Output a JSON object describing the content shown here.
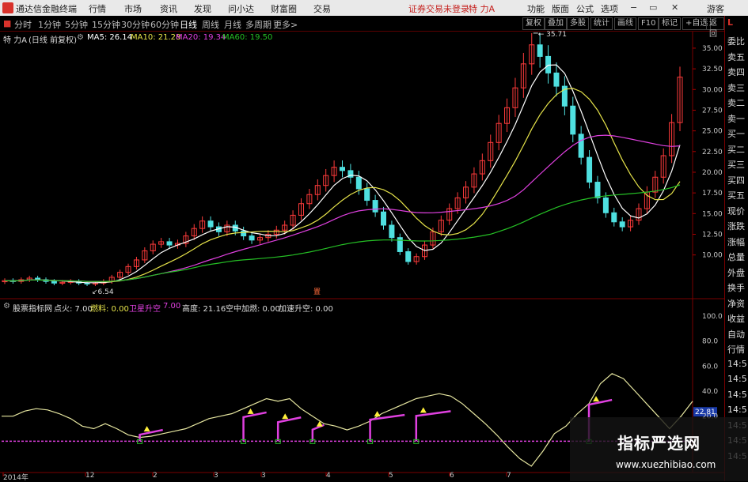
{
  "app": {
    "title": "通达信金融终端",
    "status": "证券交易未登录",
    "stock": "特 力A",
    "guest": "游客"
  },
  "menu": {
    "items": [
      "行情",
      "市场",
      "资讯",
      "发现",
      "问小达",
      "财富圈",
      "交易"
    ],
    "right": [
      "功能",
      "版面",
      "公式",
      "选项"
    ]
  },
  "window_controls": [
    "−",
    "▭",
    "✕"
  ],
  "toolbar": {
    "periods": [
      "分时",
      "1分钟",
      "5分钟",
      "15分钟",
      "30分钟",
      "60分钟",
      "日线",
      "周线",
      "月线",
      "多周期",
      "更多>"
    ],
    "selected": "日线",
    "right_buttons": [
      "复权",
      "叠加",
      "多股",
      "统计",
      "画线",
      "F10",
      "标记",
      "+自选",
      "返回"
    ]
  },
  "header": {
    "name": "特 力A",
    "adj": "(日线 前复权)",
    "ma5_label": "MA5: 26.14",
    "ma10_label": "MA10: 21.28",
    "ma20_label": "MA20: 19.34",
    "ma60_label": "MA60: 19.50"
  },
  "price_axis": [
    "35.00",
    "32.50",
    "30.00",
    "27.50",
    "25.00",
    "22.50",
    "20.00",
    "17.50",
    "15.00",
    "12.50",
    "10.00"
  ],
  "annotations": {
    "high": "35.71",
    "low": "6.54",
    "marker": "置"
  },
  "indicator": {
    "name": "股票指标网",
    "dianhuo": "点火: 7.00",
    "ranliao": "燃料: 0.00",
    "weixing": "卫星升空",
    "weixing_val": "7.00",
    "gaodu": "高度: 21.16",
    "kongzhong": "空中加燃: 0.00",
    "jiasu": "加速升空: 0.00"
  },
  "ind_axis": [
    "100.0",
    "80.0",
    "60.0",
    "40.0",
    "22.81",
    "20.0"
  ],
  "dates": [
    "2014年",
    "12",
    "2",
    "3",
    "4",
    "5",
    "6",
    "7"
  ],
  "sidebar": {
    "top": "L",
    "items": [
      "委比",
      "卖五",
      "卖四",
      "卖三",
      "卖二",
      "卖一",
      "买一",
      "买二",
      "买三",
      "买四",
      "买五",
      "现价",
      "涨跌",
      "涨幅",
      "总量",
      "外盘",
      "换手",
      "净资",
      "收益",
      "自动",
      "行情",
      "14:5",
      "14:5",
      "14:5",
      "14:5",
      "14:5",
      "14:5",
      "14:5"
    ]
  },
  "brand": {
    "title": "指标严选网",
    "url": "www.xuezhibiao.com"
  },
  "chart_data": {
    "type": "candlestick",
    "ylim": [
      5,
      37
    ],
    "ma_lines": [
      {
        "name": "MA5",
        "color": "#ffffff"
      },
      {
        "name": "MA10",
        "color": "#e6e34a"
      },
      {
        "name": "MA20",
        "color": "#e040e0"
      },
      {
        "name": "MA60",
        "color": "#25c025"
      }
    ],
    "close_series": [
      6.9,
      6.8,
      7.0,
      7.2,
      7.0,
      6.8,
      6.6,
      6.7,
      6.8,
      6.6,
      6.5,
      6.6,
      6.8,
      7.3,
      7.9,
      8.6,
      9.4,
      10.5,
      11.3,
      11.6,
      11.2,
      11.4,
      12.3,
      13.2,
      14.1,
      13.4,
      12.8,
      13.6,
      12.9,
      12.3,
      11.8,
      12.1,
      12.5,
      13.0,
      13.6,
      14.8,
      16.2,
      17.3,
      18.4,
      19.6,
      20.6,
      20.2,
      19.4,
      18.0,
      16.6,
      15.2,
      13.6,
      12.1,
      10.4,
      9.2,
      9.8,
      11.2,
      12.8,
      14.2,
      15.6,
      16.9,
      18.2,
      19.8,
      21.4,
      23.6,
      25.9,
      27.8,
      30.2,
      33.1,
      35.4,
      34.0,
      32.0,
      30.4,
      28.0,
      24.6,
      21.8,
      18.8,
      16.9,
      15.1,
      14.0,
      13.4,
      14.2,
      15.6,
      17.6,
      19.4,
      22.0,
      26.0,
      31.5
    ],
    "indicator_series": [
      {
        "name": "白线",
        "color": "#e6e6a0",
        "values": [
          20,
          20,
          24,
          26,
          25,
          22,
          18,
          12,
          10,
          14,
          10,
          5,
          3,
          4,
          6,
          8,
          10,
          14,
          18,
          20,
          22,
          26,
          30,
          34,
          32,
          34,
          26,
          20,
          14,
          12,
          9,
          12,
          16,
          22,
          26,
          30,
          34,
          36,
          38,
          36,
          30,
          22,
          14,
          5,
          -5,
          -14,
          -20,
          -8,
          6,
          12,
          22,
          30,
          46,
          54,
          50,
          40,
          30,
          20,
          10,
          20,
          32
        ]
      }
    ]
  }
}
